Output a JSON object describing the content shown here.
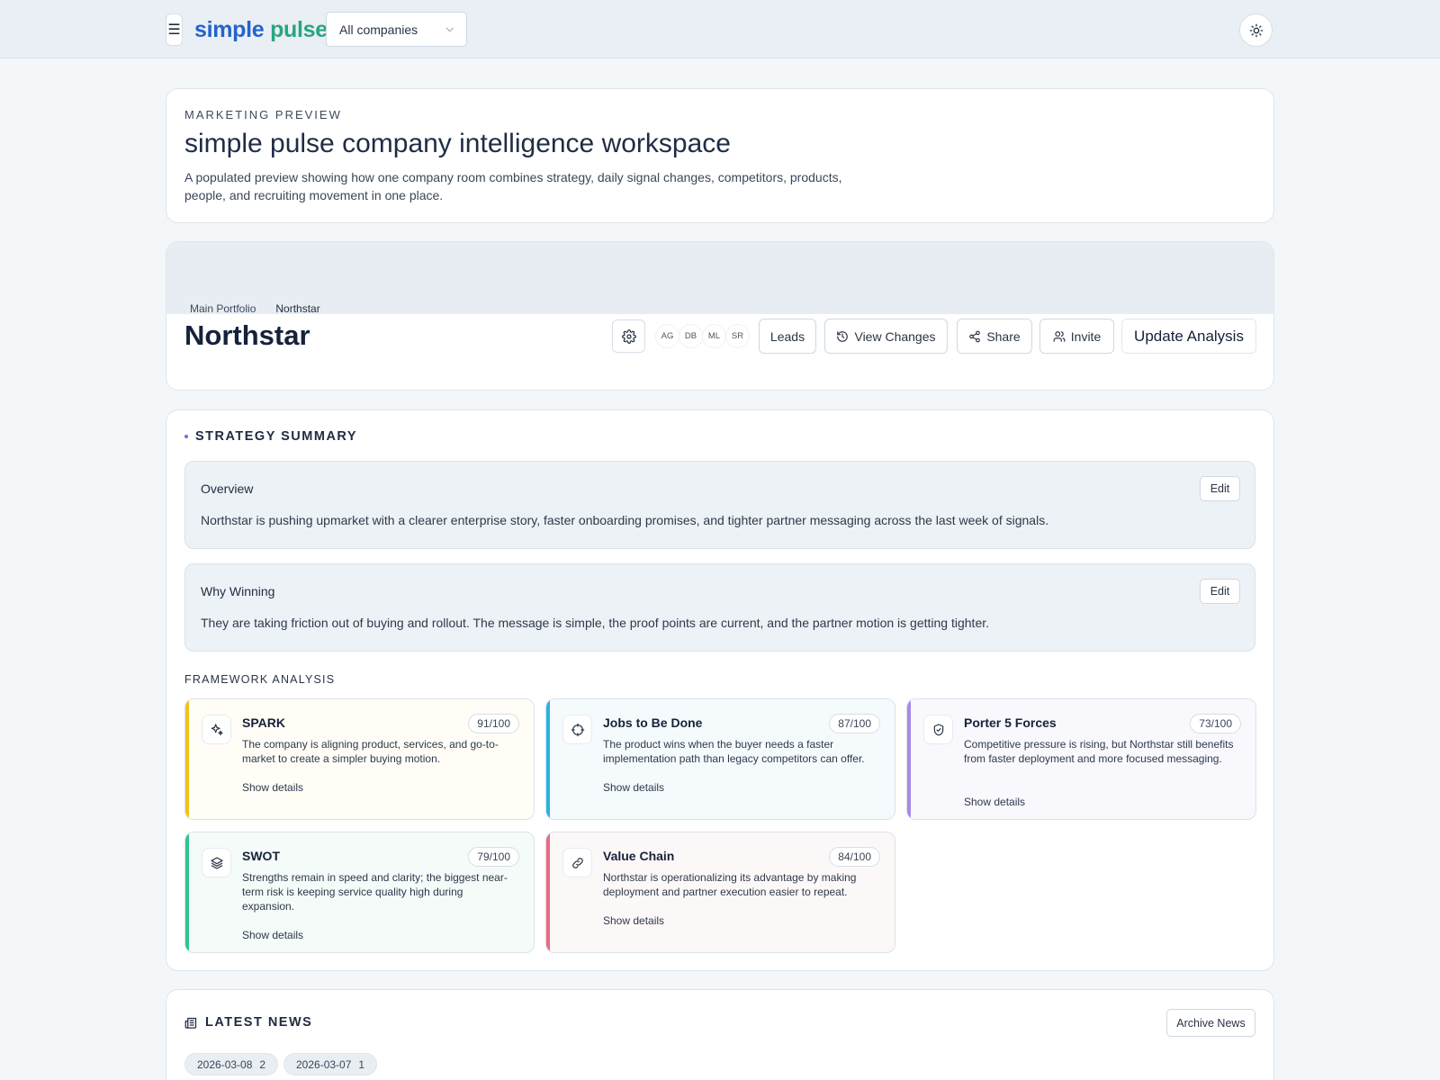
{
  "topbar": {
    "menu_icon": "hamburger-icon",
    "logo_part1": "simple",
    "logo_part2": "pulse",
    "company_select": "All companies",
    "theme_icon": "sun-icon"
  },
  "hero": {
    "eyebrow": "MARKETING PREVIEW",
    "title": "simple pulse company intelligence workspace",
    "description": "A populated preview showing how one company room combines strategy, daily signal changes, competitors, products, people, and recruiting movement in one place."
  },
  "company": {
    "breadcrumb": [
      "Main Portfolio",
      "Northstar"
    ],
    "name": "Northstar",
    "avatars": [
      "AG",
      "DB",
      "ML",
      "SR"
    ],
    "buttons": {
      "leads": "Leads",
      "view_changes": "View Changes",
      "share": "Share",
      "invite": "Invite",
      "update": "Update Analysis"
    }
  },
  "strategy": {
    "title": "STRATEGY SUMMARY",
    "overview": {
      "label": "Overview",
      "text": "Northstar is pushing upmarket with a clearer enterprise story, faster onboarding promises, and tighter partner messaging across the last week of signals.",
      "edit": "Edit"
    },
    "why_winning": {
      "label": "Why Winning",
      "text": "They are taking friction out of buying and rollout. The message is simple, the proof points are current, and the partner motion is getting tighter.",
      "edit": "Edit"
    },
    "framework_heading": "FRAMEWORK ANALYSIS",
    "frameworks": [
      {
        "name": "SPARK",
        "score": "91/100",
        "desc": "The company is aligning product, services, and go-to-market to create a simpler buying motion.",
        "link": "Show details",
        "icon": "sparkle-icon",
        "color": "#f2c21b",
        "bg": "#fffdf6"
      },
      {
        "name": "Jobs to Be Done",
        "score": "87/100",
        "desc": "The product wins when the buyer needs a faster implementation path than legacy competitors can offer.",
        "link": "Show details",
        "icon": "target-icon",
        "color": "#2bb3e0",
        "bg": "#f5fbfd"
      },
      {
        "name": "Porter 5 Forces",
        "score": "73/100",
        "desc": "Competitive pressure is rising, but Northstar still benefits from faster deployment and more focused messaging.",
        "link": "Show details",
        "icon": "shield-icon",
        "color": "#a58bea",
        "bg": "#f8f8fd"
      },
      {
        "name": "SWOT",
        "score": "79/100",
        "desc": "Strengths remain in speed and clarity; the biggest near-term risk is keeping service quality high during expansion.",
        "link": "Show details",
        "icon": "layers-icon",
        "color": "#2ec48f",
        "bg": "#f4fbf8"
      },
      {
        "name": "Value Chain",
        "score": "84/100",
        "desc": "Northstar is operationalizing its advantage by making deployment and partner execution easier to repeat.",
        "link": "Show details",
        "icon": "link-icon",
        "color": "#ea6a84",
        "bg": "#fdf8f8"
      }
    ]
  },
  "news": {
    "title": "LATEST NEWS",
    "archive": "Archive News",
    "dates": [
      {
        "date": "2026-03-08",
        "count": "2"
      },
      {
        "date": "2026-03-07",
        "count": "1"
      }
    ]
  }
}
